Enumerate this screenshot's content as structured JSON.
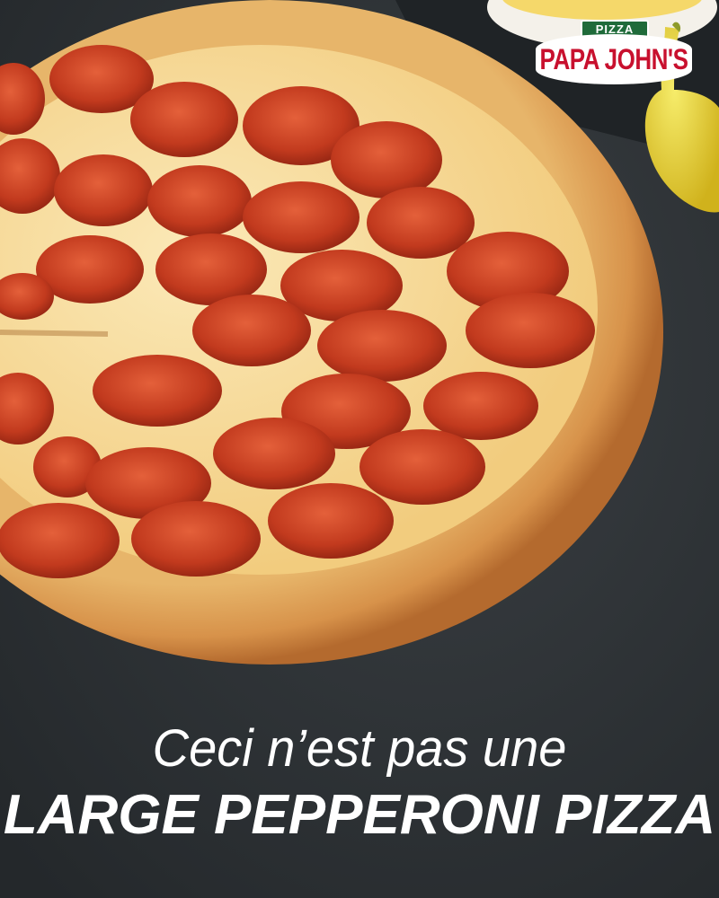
{
  "brand": {
    "logo_top": "PIZZA",
    "logo_main": "PAPA JOHN'S"
  },
  "tagline": {
    "line1": "Ceci n’est pas une",
    "line2": "LARGE PEPPERONI PIZZA"
  },
  "colors": {
    "background": "#2b3033",
    "logo_red": "#c8102e",
    "logo_green": "#1f6b3a",
    "text": "#ffffff"
  }
}
